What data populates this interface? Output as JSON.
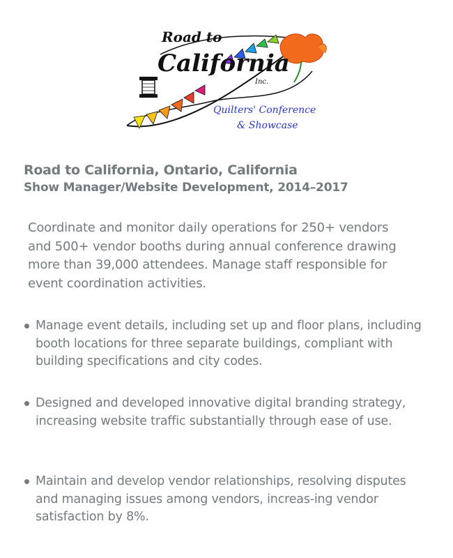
{
  "logo": {
    "line1": "Road to",
    "line2": "California",
    "line3": "Inc.",
    "tagline1": "Quilters' Conference",
    "tagline2": "& Showcase",
    "colors": {
      "text": "#111111",
      "tagline": "#2a36c8",
      "poppy": "#f26a1b",
      "triangles": [
        "#f7e21a",
        "#f7c21a",
        "#f79a1a",
        "#ef6a1e",
        "#e8402a",
        "#d81f7a",
        "#8a2be2",
        "#2c5ee8",
        "#1fa0e8",
        "#2fbf4a",
        "#8fd12a"
      ]
    }
  },
  "heading": {
    "org": "Road to California, Ontario, California",
    "role": "Show Manager/Website Development, 2014–2017"
  },
  "summary": "Coordinate and monitor daily operations for 250+ vendors and 500+ vendor booths during annual conference drawing more than 39,000 attendees. Manage staff responsible for event coordination activities.",
  "bullets": [
    "Manage event details, including set up and floor plans, including booth locations for three separate buildings, compliant with building specifications and city codes.",
    "Designed and developed innovative digital branding strategy, increasing website traffic substantially through ease of use.",
    "Maintain and develop vendor relationships, resolving disputes and managing issues among vendors, increas-ing vendor satisfaction by 8%."
  ],
  "colors": {
    "text": "#737b7e"
  }
}
